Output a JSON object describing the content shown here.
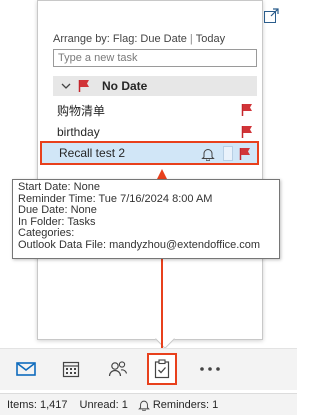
{
  "peek": {
    "arrange_by": "Arrange by: Flag: Due Date",
    "arrange_view": "Today",
    "new_task_placeholder": "Type a new task",
    "group_label": "No Date",
    "tasks": [
      {
        "title": "购物清单"
      },
      {
        "title": "birthday"
      },
      {
        "title": "Recall test 2"
      }
    ]
  },
  "tooltip": {
    "start_date": "Start Date: None",
    "reminder_time": "Reminder Time: Tue 7/16/2024 8:00 AM",
    "due_date": "Due Date: None",
    "in_folder": "In Folder: Tasks",
    "categories": "Categories:",
    "data_file": "Outlook Data File: mandyzhou@extendoffice.com"
  },
  "nav": {
    "items": [
      {
        "icon": "mail-icon"
      },
      {
        "icon": "calendar-icon"
      },
      {
        "icon": "people-icon"
      },
      {
        "icon": "tasks-icon"
      },
      {
        "icon": "more-icon"
      }
    ]
  },
  "status": {
    "items": "Items: 1,417",
    "unread": "Unread: 1",
    "reminders": "Reminders: 1"
  },
  "colors": {
    "accent_blue": "#0f6cbd",
    "flag_red": "#d13438",
    "highlight_orange": "#e8401c",
    "selection_blue": "#d1e6f7"
  }
}
